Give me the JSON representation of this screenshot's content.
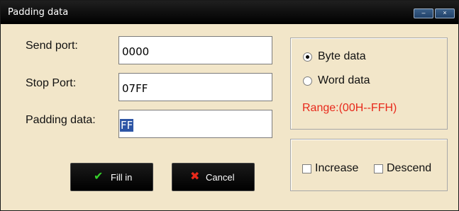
{
  "window": {
    "title": "Padding data",
    "minimize_glyph": "–",
    "close_glyph": "×"
  },
  "form": {
    "send_port_label": "Send port:",
    "send_port_value": "0000",
    "stop_port_label": "Stop Port:",
    "stop_port_value": "07FF",
    "padding_label": "Padding data:",
    "padding_value": "FF"
  },
  "data_type": {
    "byte_label": "Byte data",
    "byte_selected": true,
    "word_label": "Word data",
    "word_selected": false,
    "range_text": "Range:(00H--FFH)",
    "range_color": "#e8291b"
  },
  "options": {
    "increase_label": "Increase",
    "increase_checked": false,
    "descend_label": "Descend",
    "descend_checked": false
  },
  "buttons": {
    "fill_label": "Fill in",
    "fill_icon": "check-icon",
    "cancel_label": "Cancel",
    "cancel_icon": "x-icon"
  },
  "colors": {
    "background": "#f2e6c9",
    "titlebar": "#000000",
    "selection": "#2d55a5"
  }
}
